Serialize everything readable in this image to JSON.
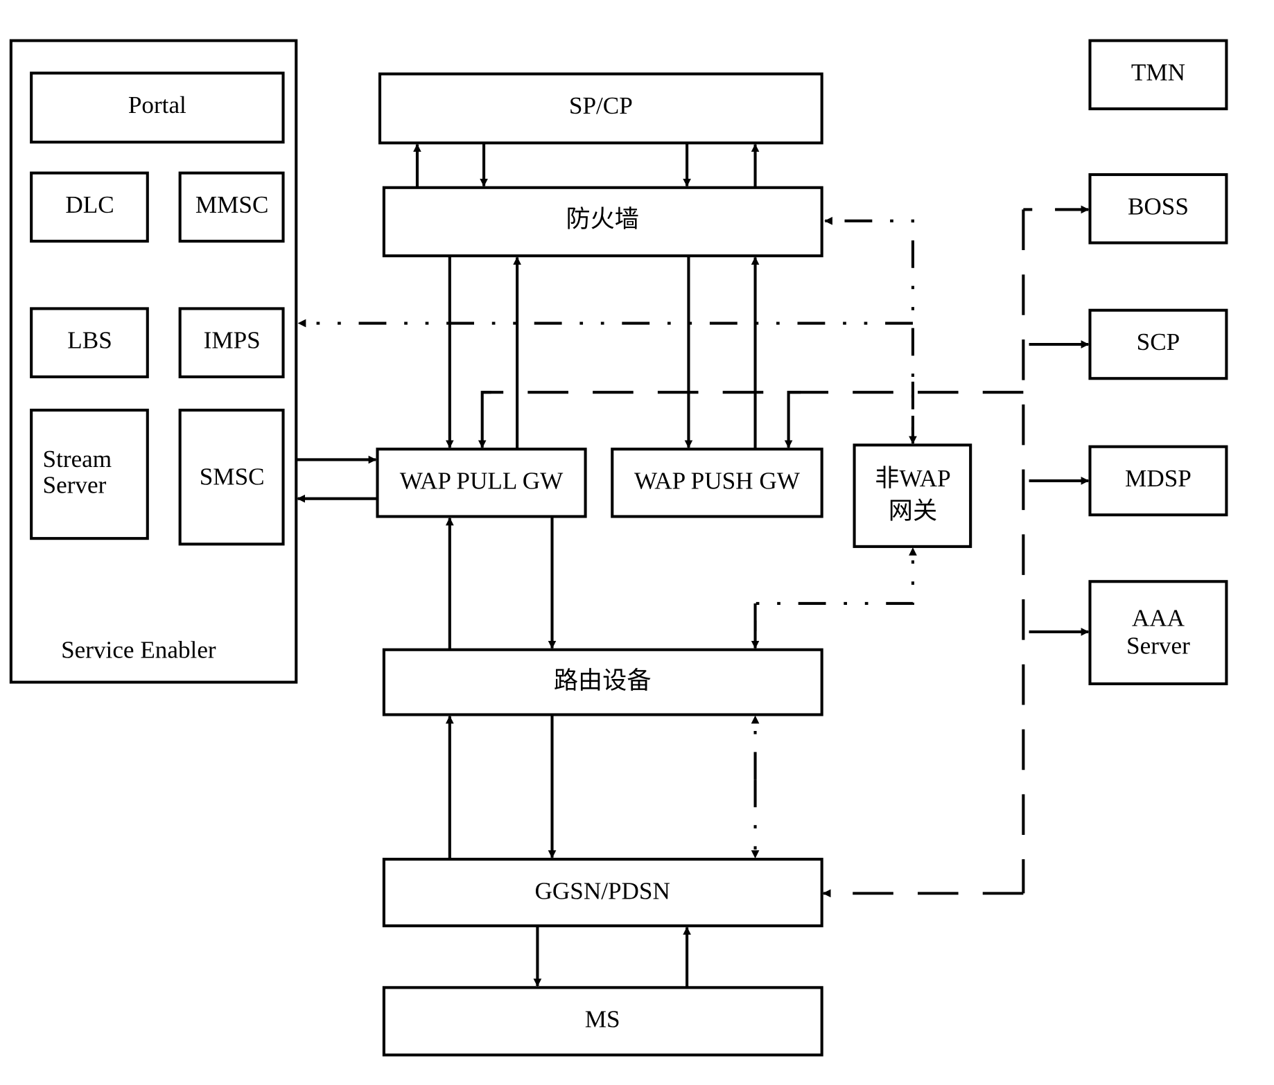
{
  "diagram": {
    "service_enabler": {
      "label": "Service Enabler",
      "portal": "Portal",
      "dlc": "DLC",
      "mmsc": "MMSC",
      "lbs": "LBS",
      "imps": "IMPS",
      "stream_server_line1": "Stream",
      "stream_server_line2": "Server",
      "smsc": "SMSC"
    },
    "core": {
      "sp_cp": "SP/CP",
      "firewall": "防火墙",
      "wap_pull_gw": "WAP PULL GW",
      "wap_push_gw": "WAP PUSH GW",
      "non_wap_gw_line1": "非WAP",
      "non_wap_gw_line2": "网关",
      "router": "路由设备",
      "ggsn_pdsn": "GGSN/PDSN",
      "ms": "MS"
    },
    "right": {
      "tmn": "TMN",
      "boss": "BOSS",
      "scp": "SCP",
      "mdsp": "MDSP",
      "aaa_line1": "AAA",
      "aaa_line2": "Server"
    }
  }
}
